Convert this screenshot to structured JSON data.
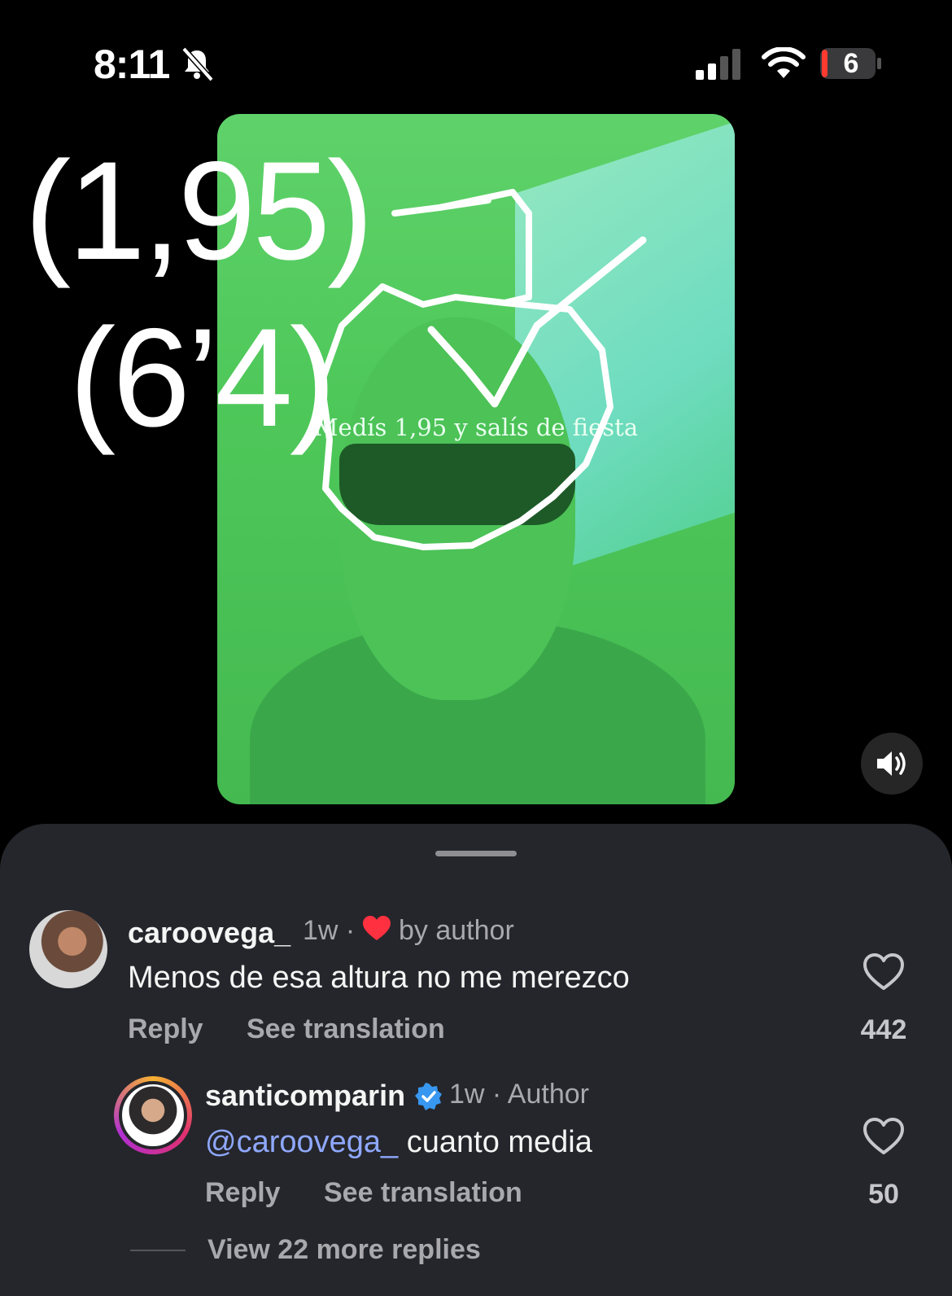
{
  "status_bar": {
    "time": "8:11",
    "battery": "6"
  },
  "video": {
    "caption": "Medís 1,95 y salís de fiesta",
    "overlay_line1": "(1,95)",
    "overlay_line2": "(6’4)"
  },
  "comments": [
    {
      "username": "caroovega_",
      "time": "1w ·",
      "badge": "by author",
      "text": "Menos de esa altura no me merezco",
      "reply_label": "Reply",
      "translate_label": "See translation",
      "likes": "442"
    },
    {
      "username": "santicomparin",
      "time": "1w · Author",
      "mention": "@caroovega_",
      "text": " cuanto media",
      "reply_label": "Reply",
      "translate_label": "See translation",
      "likes": "50"
    }
  ],
  "view_more": "View 22 more replies",
  "colors": {
    "sheet": "#25262b",
    "mention": "#8fa8ff",
    "heart_red": "#ff3040",
    "verified": "#3897f0"
  }
}
